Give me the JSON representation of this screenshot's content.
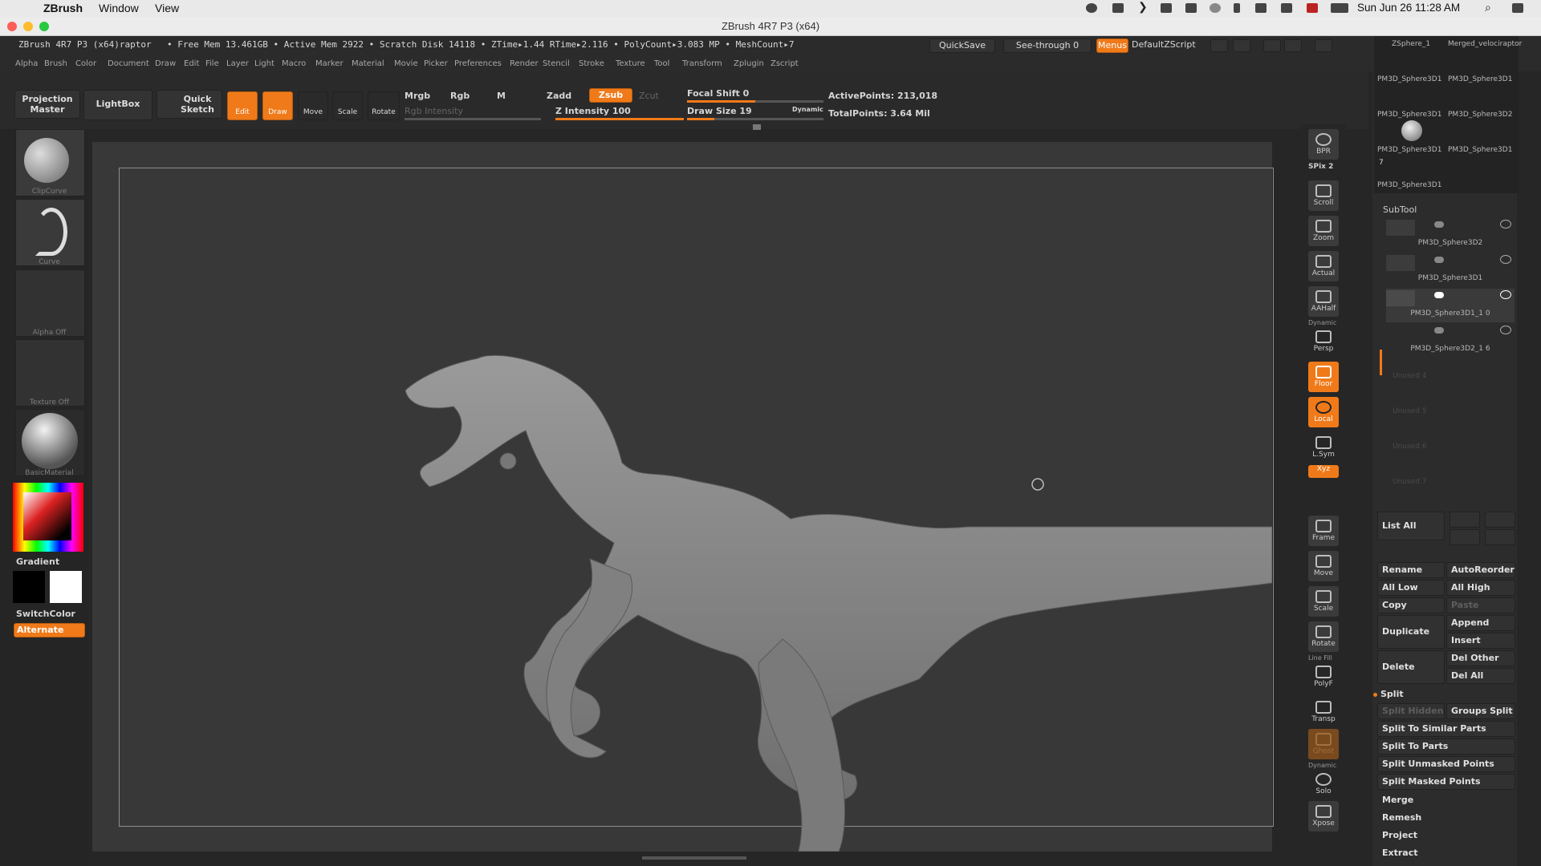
{
  "menubar": {
    "app_name": "ZBrush",
    "items": [
      "Window",
      "View"
    ],
    "datetime": "Sun Jun 26  11:28 AM"
  },
  "window": {
    "title": "ZBrush 4R7 P3 (x64)"
  },
  "status": {
    "doc": "ZBrush 4R7 P3 (x64)raptor",
    "mem": "• Free Mem 13.461GB • Active Mem 2922 • Scratch Disk 14118 •  ZTime▸1.44 RTime▸2.116 • PolyCount▸3.083 MP • MeshCount▸7",
    "quicksave": "QuickSave",
    "see_through": "See-through  0",
    "menus": "Menus",
    "defaultzscript": "DefaultZScript"
  },
  "main_menu": [
    "Alpha",
    "Brush",
    "Color",
    "Document",
    "Draw",
    "Edit",
    "File",
    "Layer",
    "Light",
    "Macro",
    "Marker",
    "Material",
    "Movie",
    "Picker",
    "Preferences",
    "Render",
    "Stencil",
    "Stroke",
    "Texture",
    "Tool",
    "Transform",
    "Zplugin",
    "Zscript"
  ],
  "shelf": {
    "projection_master": "Projection Master",
    "lightbox": "LightBox",
    "quick_sketch": "Quick Sketch",
    "edit": "Edit",
    "draw": "Draw",
    "move": "Move",
    "scale": "Scale",
    "rotate": "Rotate",
    "mrgb": "Mrgb",
    "rgb": "Rgb",
    "m": "M",
    "rgb_intensity": "Rgb Intensity",
    "zadd": "Zadd",
    "zsub": "Zsub",
    "zcut": "Zcut",
    "z_intensity": "Z Intensity 100",
    "focal_shift": "Focal Shift 0",
    "draw_size": "Draw Size 19",
    "dynamic": "Dynamic",
    "active_points": "ActivePoints: 213,018",
    "total_points": "TotalPoints: 3.64 Mil"
  },
  "left_tray": {
    "clipcurve": "ClipCurve",
    "curve": "Curve",
    "alpha": "Alpha Off",
    "texture": "Texture Off",
    "material": "BasicMaterial",
    "gradient": "Gradient",
    "switchcolor": "SwitchColor",
    "alternate": "Alternate"
  },
  "right_toolbar": [
    "BPR",
    "SPix 2",
    "Scroll",
    "Zoom",
    "Actual",
    "AAHalf",
    "Persp",
    "Floor",
    "Local",
    "L.Sym",
    "Xyz",
    "Frame",
    "Move",
    "Scale",
    "Rotate",
    "PolyF",
    "Transp",
    "Ghost",
    "Solo",
    "Xpose"
  ],
  "right_toolbar_small": {
    "dynamic": "Dynamic",
    "line_fill": "Line Fill",
    "dynamic2": "Dynamic"
  },
  "tool_thumbs": [
    "ZSphere_1",
    "Merged_velociraptor",
    "PM3D_Sphere3D1",
    "PM3D_Sphere3D1",
    "PM3D_Sphere3D1",
    "PM3D_Sphere3D2",
    "PM3D_Sphere3D1",
    "PM3D_Sphere3D1",
    "7",
    "PM3D_Sphere3D1"
  ],
  "subtool": {
    "title": "SubTool",
    "items": [
      "PM3D_Sphere3D2",
      "PM3D_Sphere3D1",
      "PM3D_Sphere3D1_1 0",
      "PM3D_Sphere3D2_1 6"
    ],
    "unused": [
      "Unused 4",
      "Unused 5",
      "Unused 6",
      "Unused 7"
    ],
    "list_all": "List All",
    "rename": "Rename",
    "autoreorder": "AutoReorder",
    "all_low": "All Low",
    "all_high": "All High",
    "copy": "Copy",
    "paste": "Paste",
    "duplicate": "Duplicate",
    "append": "Append",
    "insert": "Insert",
    "delete": "Delete",
    "del_other": "Del Other",
    "del_all": "Del All",
    "split": "Split",
    "split_hidden": "Split Hidden",
    "groups_split": "Groups Split",
    "split_similar": "Split To Similar Parts",
    "split_parts": "Split To Parts",
    "split_unmasked": "Split Unmasked Points",
    "split_masked": "Split Masked Points",
    "merge": "Merge",
    "remesh": "Remesh",
    "project": "Project",
    "extract": "Extract"
  }
}
